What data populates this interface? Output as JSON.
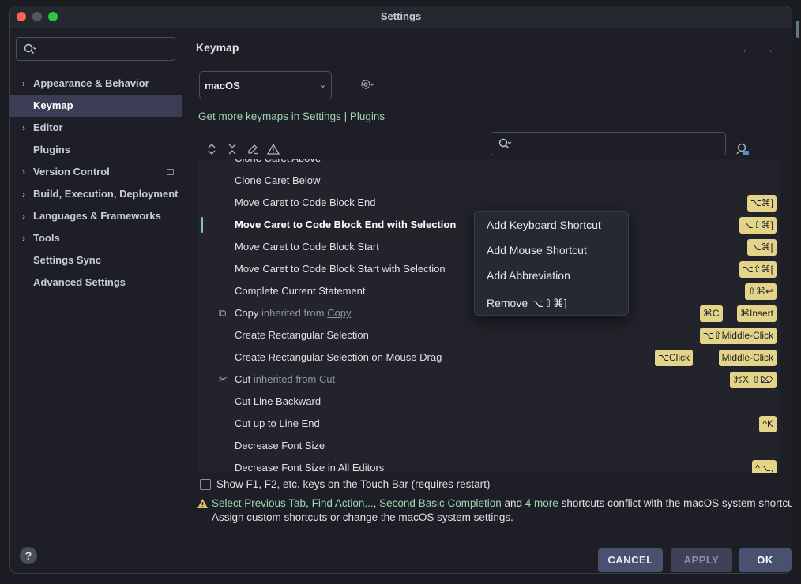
{
  "window": {
    "title": "Settings"
  },
  "sidebar": {
    "search_placeholder": "",
    "items": [
      {
        "label": "Appearance & Behavior",
        "expandable": true
      },
      {
        "label": "Keymap",
        "selected": true
      },
      {
        "label": "Editor",
        "expandable": true
      },
      {
        "label": "Plugins"
      },
      {
        "label": "Version Control",
        "expandable": true
      },
      {
        "label": "Build, Execution, Deployment",
        "expandable": true
      },
      {
        "label": "Languages & Frameworks",
        "expandable": true
      },
      {
        "label": "Tools",
        "expandable": true
      },
      {
        "label": "Settings Sync"
      },
      {
        "label": "Advanced Settings"
      }
    ],
    "help_label": "?"
  },
  "main": {
    "title": "Keymap",
    "keymap_selected": "macOS",
    "more_keymaps": "Get more keymaps in Settings | Plugins",
    "list": [
      {
        "name": "Clone Caret Above",
        "shortcuts": []
      },
      {
        "name": "Clone Caret Below",
        "shortcuts": []
      },
      {
        "name": "Move Caret to Code Block End",
        "shortcuts": [
          "⌥⌘]"
        ]
      },
      {
        "name": "Move Caret to Code Block End with Selection",
        "shortcuts": [
          "⌥⇧⌘]"
        ],
        "selected": true
      },
      {
        "name": "Move Caret to Code Block Start",
        "shortcuts": [
          "⌥⌘["
        ]
      },
      {
        "name": "Move Caret to Code Block Start with Selection",
        "shortcuts": [
          "⌥⇧⌘["
        ]
      },
      {
        "name": "Complete Current Statement",
        "shortcuts": [
          "⇧⌘↩"
        ]
      },
      {
        "name": "Copy",
        "inherited_text": "inherited from",
        "inherited_link": "Copy",
        "shortcuts": [
          "⌘C",
          "⌘Insert"
        ]
      },
      {
        "name": "Create Rectangular Selection",
        "shortcuts": [
          "⌥⇧Middle-Click"
        ]
      },
      {
        "name": "Create Rectangular Selection on Mouse Drag",
        "shortcuts": [
          "⌥Click",
          "Middle-Click"
        ]
      },
      {
        "name": "Cut",
        "inherited_text": "inherited from",
        "inherited_link": "Cut",
        "shortcuts": [
          "⌘X",
          "⇧⌦"
        ]
      },
      {
        "name": "Cut Line Backward",
        "shortcuts": []
      },
      {
        "name": "Cut up to Line End",
        "shortcuts": [
          "^K"
        ]
      },
      {
        "name": "Decrease Font Size",
        "shortcuts": []
      },
      {
        "name": "Decrease Font Size in All Editors",
        "shortcuts": [
          "^⌥,"
        ]
      }
    ],
    "context_menu": [
      "Add Keyboard Shortcut",
      "Add Mouse Shortcut",
      "Add Abbreviation",
      "Remove ⌥⇧⌘]"
    ],
    "touchbar_label": "Show F1, F2, etc. keys on the Touch Bar (requires restart)",
    "warning": {
      "link1": "Select Previous Tab",
      "sep1": ", ",
      "link2": "Find Action...",
      "sep2": ", ",
      "link3": "Second Basic Completion",
      "and": " and ",
      "link4": "4 more",
      "rest": " shortcuts conflict with the macOS system shortcu",
      "line2": "Assign custom shortcuts or change the macOS system settings."
    }
  },
  "buttons": {
    "cancel": "CANCEL",
    "apply": "APPLY",
    "ok": "OK"
  },
  "colors": {
    "accent_green": "#9dd4b0",
    "shortcut_bg": "#e3d489",
    "selection_bg": "#3a3d53",
    "warning": "#e3c05c"
  }
}
